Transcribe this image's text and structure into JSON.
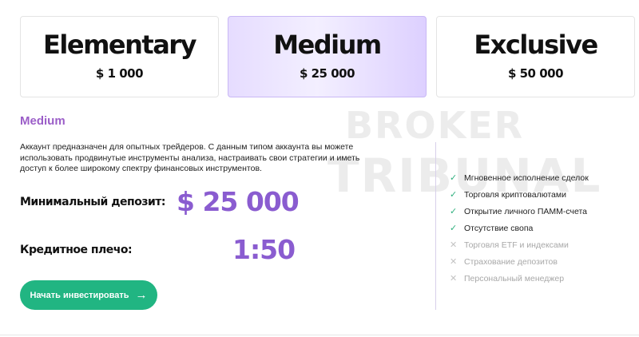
{
  "watermark": {
    "line1": "BROKER",
    "line2": "TRIBUNAL"
  },
  "plans": [
    {
      "name": "Elementary",
      "price": "$ 1 000",
      "selected": false
    },
    {
      "name": "Medium",
      "price": "$ 25 000",
      "selected": true
    },
    {
      "name": "Exclusive",
      "price": "$ 50 000",
      "selected": false
    }
  ],
  "details": {
    "title": "Medium",
    "description": "Аккаунт предназначен для опытных трейдеров. С данным типом аккаунта вы можете использовать продвинутые инструменты анализа, настраивать свои стратегии и иметь доступ к более широкому спектру финансовых инструментов.",
    "deposit_label": "Минимальный депозит:",
    "deposit_value": "$ 25 000",
    "leverage_label": "Кредитное плечо:",
    "leverage_value": "1:50",
    "button_label": "Начать инвестировать",
    "button_icon": "arrow-right-icon"
  },
  "features": [
    {
      "text": "Мгновенное исполнение сделок",
      "included": true
    },
    {
      "text": "Торговля криптовалютами",
      "included": true
    },
    {
      "text": "Открытие личного ПАММ-счета",
      "included": true
    },
    {
      "text": "Отсутствие свопа",
      "included": true
    },
    {
      "text": "Торговля ETF и индексами",
      "included": false
    },
    {
      "text": "Страхование депозитов",
      "included": false
    },
    {
      "text": "Персональный менеджер",
      "included": false
    }
  ],
  "colors": {
    "accent_purple": "#8a5cd0",
    "button_green": "#21b582",
    "check_green": "#2fb07e",
    "cross_gray": "#c3c3c3",
    "selected_card": "#e6dcff"
  }
}
